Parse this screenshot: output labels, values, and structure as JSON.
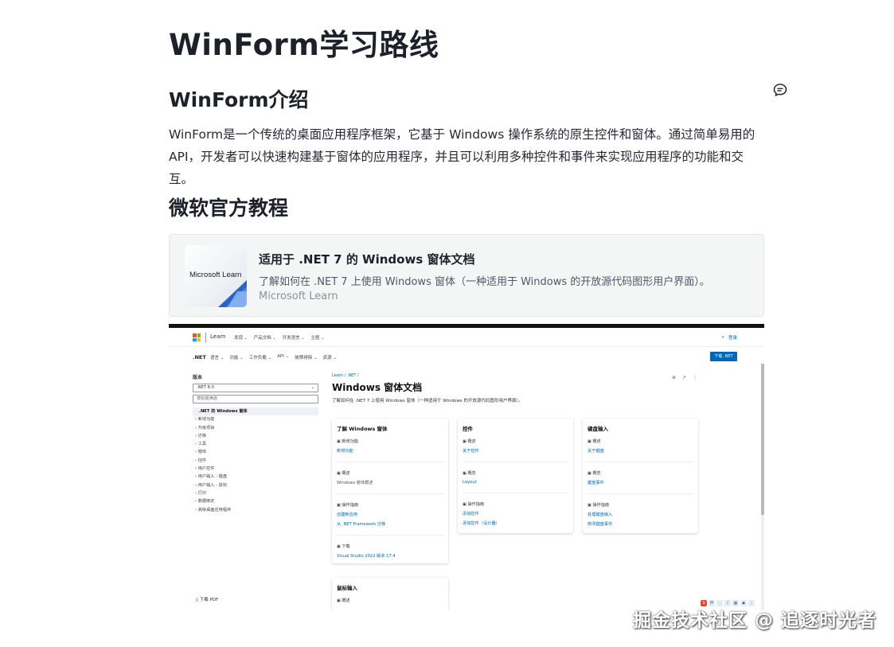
{
  "article": {
    "title": "WinForm学习路线",
    "section1_title": "WinForm介绍",
    "intro_line1": "WinForm是一个传统的桌面应用程序框架，它基于 Windows 操作系统的原生控件和窗体。通过简单易用的",
    "intro_line2": "API，开发者可以快速构建基于窗体的应用程序，并且可以利用多种控件和事件来实现应用程序的功能和交互。",
    "section2_title": "微软官方教程"
  },
  "link_card": {
    "title": "适用于 .NET 7 的 Windows 窗体文档",
    "description": "了解如何在 .NET 7 上使用 Windows 窗体（一种适用于 Windows 的开放源代码图形用户界面）。",
    "source": "Microsoft Learn",
    "thumb_text": "Microsoft Learn"
  },
  "embedded_screenshot": {
    "top_nav": {
      "brand": "Learn",
      "items": [
        "发现",
        "产品文档",
        "开发语言",
        "主题"
      ],
      "search_icon": "search-icon",
      "signin": "登录"
    },
    "sub_nav": {
      "product": ".NET",
      "items": [
        "语言",
        "功能",
        "工作负载",
        "API",
        "故障排除",
        "资源"
      ],
      "download": "下载 .NET"
    },
    "sidebar": {
      "version_label": "版本",
      "version_value": ".NET 8.0",
      "filter_placeholder": "按标题筛选",
      "items": [
        ".NET 的 Windows 窗体",
        "新增功能",
        "升级项目",
        "迁移",
        "工具",
        "窗体",
        "控件",
        "用户控件",
        "用户输入 - 键盘",
        "用户输入 - 鼠标",
        "打印",
        "数据绑定",
        "高级桌面应用程序"
      ],
      "download_pdf": "下载 PDF"
    },
    "main": {
      "breadcrumb": "Learn / .NET /",
      "title": "Windows 窗体文档",
      "lead": "了解如何在 .NET 7 上使用 Windows 窗体（一种适用于 Windows 的开放源代码图形用户界面）。",
      "cards": [
        {
          "title": "了解 Windows 窗体",
          "sections": [
            {
              "head": "新增功能",
              "items": [
                {
                  "text": "新增功能",
                  "link": true
                }
              ]
            },
            {
              "head": "概述",
              "items": [
                {
                  "text": "Windows 窗体概述",
                  "link": false
                }
              ]
            },
            {
              "head": "操作指南",
              "items": [
                {
                  "text": "创建新应用",
                  "link": true
                },
                {
                  "text": "从 .NET Framework 迁移",
                  "link": true
                }
              ]
            },
            {
              "head": "下载",
              "items": [
                {
                  "text": "Visual Studio 2022 版本 17.4",
                  "link": true
                }
              ]
            }
          ]
        },
        {
          "title": "控件",
          "sections": [
            {
              "head": "概述",
              "items": [
                {
                  "text": "关于控件",
                  "link": true
                }
              ]
            },
            {
              "head": "概念",
              "items": [
                {
                  "text": "Layout",
                  "link": true
                }
              ]
            },
            {
              "head": "操作指南",
              "items": [
                {
                  "text": "添加控件",
                  "link": true
                },
                {
                  "text": "添加控件（设计器）",
                  "link": true
                }
              ]
            }
          ]
        },
        {
          "title": "键盘输入",
          "sections": [
            {
              "head": "概述",
              "items": [
                {
                  "text": "关于键盘",
                  "link": true
                }
              ]
            },
            {
              "head": "概念",
              "items": [
                {
                  "text": "键盘事件",
                  "link": true
                }
              ]
            },
            {
              "head": "操作指南",
              "items": [
                {
                  "text": "处理键盘输入",
                  "link": true
                },
                {
                  "text": "修改键盘事件",
                  "link": true
                }
              ]
            }
          ]
        },
        {
          "title": "鼠标输入",
          "sections": [
            {
              "head": "概述",
              "items": []
            }
          ]
        }
      ]
    }
  },
  "watermark": "掘金技术社区 @ 追逐时光者",
  "colors": {
    "ms_blue": "#0067b8",
    "card_bg": "#f4f5f5",
    "text_main": "#252933",
    "text_muted": "#8a919f"
  }
}
